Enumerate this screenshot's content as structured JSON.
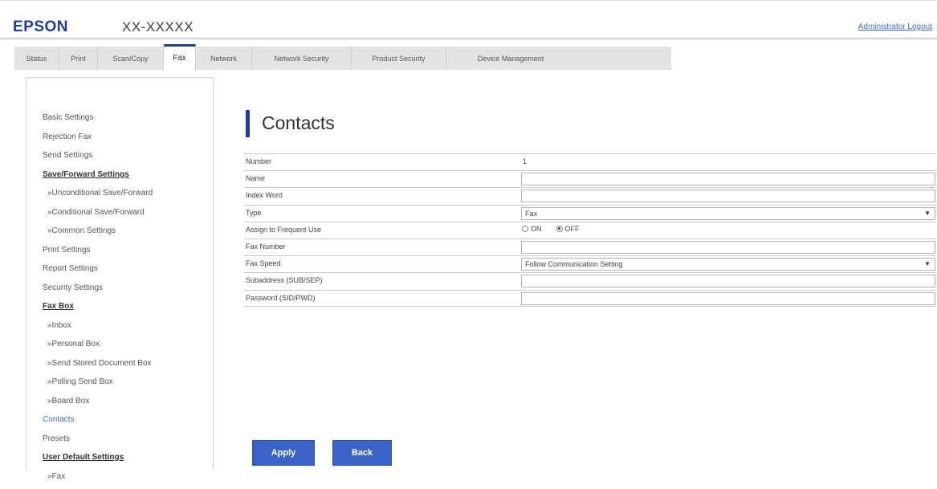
{
  "header": {
    "logo": "EPSON",
    "model": "XX-XXXXX",
    "admin_link": "Administrator Logout"
  },
  "tabs": [
    {
      "label": "Status",
      "active": false
    },
    {
      "label": "Print",
      "active": false
    },
    {
      "label": "Scan/Copy",
      "active": false
    },
    {
      "label": "Fax",
      "active": true
    },
    {
      "label": "Network",
      "active": false
    },
    {
      "label": "Network Security",
      "active": false
    },
    {
      "label": "Product Security",
      "active": false
    },
    {
      "label": "Device Management",
      "active": false
    }
  ],
  "sidebar": {
    "items": [
      {
        "label": "Basic Settings"
      },
      {
        "label": "Rejection Fax"
      },
      {
        "label": "Send Settings"
      },
      {
        "label": "Save/Forward Settings"
      },
      {
        "label": "»Unconditional Save/Forward"
      },
      {
        "label": "»Conditional Save/Forward"
      },
      {
        "label": "»Common Settings"
      },
      {
        "label": "Print Settings"
      },
      {
        "label": "Report Settings"
      },
      {
        "label": "Security Settings"
      },
      {
        "label": "Fax Box"
      },
      {
        "label": "»Inbox"
      },
      {
        "label": "»Personal Box"
      },
      {
        "label": "»Send Stored Document Box"
      },
      {
        "label": "»Polling Send Box"
      },
      {
        "label": "»Board Box"
      },
      {
        "label": "Contacts"
      },
      {
        "label": "Presets"
      },
      {
        "label": "User Default Settings"
      },
      {
        "label": "»Fax"
      }
    ]
  },
  "main": {
    "title": "Contacts",
    "fields": {
      "number_label": "Number",
      "number_value": "1",
      "name_label": "Name",
      "index_word_label": "Index Word",
      "type_label": "Type",
      "type_value": "Fax",
      "frequent_use_label": "Assign to Frequent Use",
      "frequent_on": "ON",
      "frequent_off": "OFF",
      "fax_number_label": "Fax Number",
      "fax_speed_label": "Fax Speed",
      "fax_speed_value": "Follow Communication Setting",
      "subaddress_label": "Subaddress (SUB/SEP)",
      "password_label": "Password (SID/PWD)"
    },
    "buttons": {
      "apply": "Apply",
      "back": "Back"
    }
  }
}
